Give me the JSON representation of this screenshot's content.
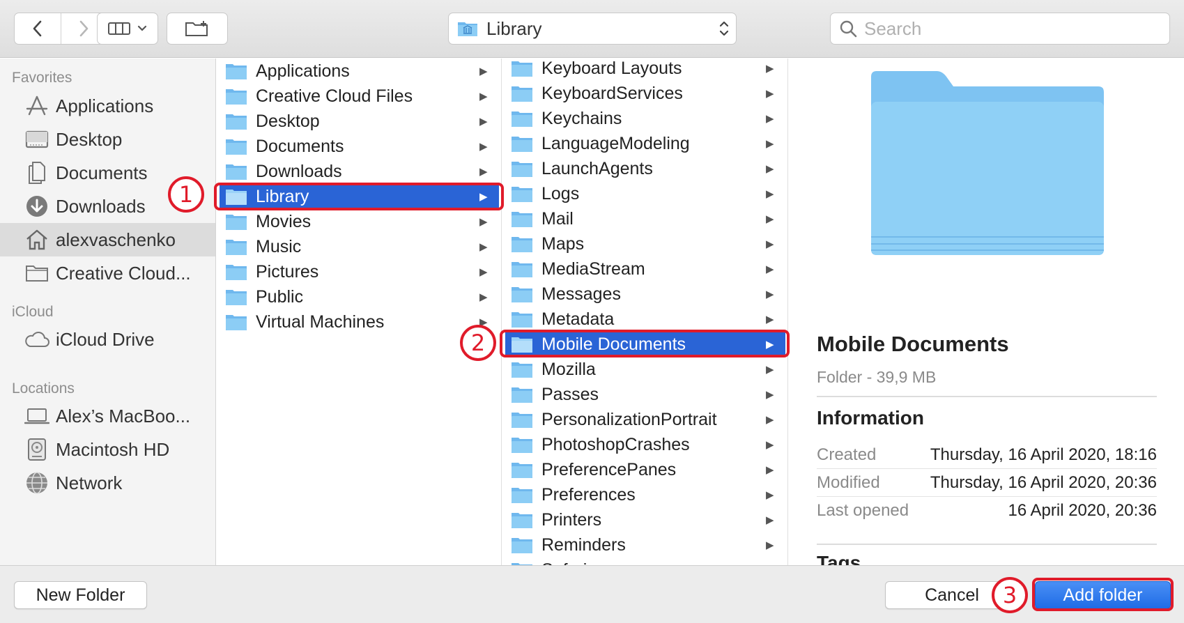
{
  "toolbar": {
    "path_label": "Library",
    "search_placeholder": "Search"
  },
  "sidebar": {
    "sections": [
      {
        "title": "Favorites",
        "items": [
          {
            "label": "Applications",
            "icon": "applications-icon",
            "selected": false
          },
          {
            "label": "Desktop",
            "icon": "desktop-icon",
            "selected": false
          },
          {
            "label": "Documents",
            "icon": "documents-icon",
            "selected": false
          },
          {
            "label": "Downloads",
            "icon": "downloads-icon",
            "selected": false
          },
          {
            "label": "alexvaschenko",
            "icon": "home-icon",
            "selected": true
          },
          {
            "label": "Creative Cloud...",
            "icon": "folder-icon",
            "selected": false
          }
        ]
      },
      {
        "title": "iCloud",
        "items": [
          {
            "label": "iCloud Drive",
            "icon": "cloud-icon",
            "selected": false
          }
        ]
      },
      {
        "title": "Locations",
        "items": [
          {
            "label": "Alex’s MacBoo...",
            "icon": "laptop-icon",
            "selected": false
          },
          {
            "label": "Macintosh HD",
            "icon": "disk-icon",
            "selected": false
          },
          {
            "label": "Network",
            "icon": "network-icon",
            "selected": false
          }
        ]
      }
    ]
  },
  "column1": {
    "items": [
      {
        "label": "Applications",
        "selected": false
      },
      {
        "label": "Creative Cloud Files",
        "selected": false
      },
      {
        "label": "Desktop",
        "selected": false
      },
      {
        "label": "Documents",
        "selected": false
      },
      {
        "label": "Downloads",
        "selected": false
      },
      {
        "label": "Library",
        "selected": true
      },
      {
        "label": "Movies",
        "selected": false
      },
      {
        "label": "Music",
        "selected": false
      },
      {
        "label": "Pictures",
        "selected": false
      },
      {
        "label": "Public",
        "selected": false
      },
      {
        "label": "Virtual Machines",
        "selected": false
      }
    ]
  },
  "column2": {
    "items": [
      {
        "label": "Keyboard Layouts",
        "selected": false
      },
      {
        "label": "KeyboardServices",
        "selected": false
      },
      {
        "label": "Keychains",
        "selected": false
      },
      {
        "label": "LanguageModeling",
        "selected": false
      },
      {
        "label": "LaunchAgents",
        "selected": false
      },
      {
        "label": "Logs",
        "selected": false
      },
      {
        "label": "Mail",
        "selected": false
      },
      {
        "label": "Maps",
        "selected": false
      },
      {
        "label": "MediaStream",
        "selected": false
      },
      {
        "label": "Messages",
        "selected": false
      },
      {
        "label": "Metadata",
        "selected": false
      },
      {
        "label": "Mobile Documents",
        "selected": true
      },
      {
        "label": "Mozilla",
        "selected": false
      },
      {
        "label": "Passes",
        "selected": false
      },
      {
        "label": "PersonalizationPortrait",
        "selected": false
      },
      {
        "label": "PhotoshopCrashes",
        "selected": false
      },
      {
        "label": "PreferencePanes",
        "selected": false
      },
      {
        "label": "Preferences",
        "selected": false
      },
      {
        "label": "Printers",
        "selected": false
      },
      {
        "label": "Reminders",
        "selected": false
      },
      {
        "label": "Safari",
        "selected": false
      }
    ]
  },
  "preview": {
    "title": "Mobile Documents",
    "subtitle": "Folder - 39,9 MB",
    "info_heading": "Information",
    "rows": [
      {
        "key": "Created",
        "value": "Thursday, 16 April 2020, 18:16"
      },
      {
        "key": "Modified",
        "value": "Thursday, 16 April 2020, 20:36"
      },
      {
        "key": "Last opened",
        "value": "16 April 2020, 20:36"
      }
    ],
    "tags_heading": "Tags"
  },
  "bottom": {
    "new_folder": "New Folder",
    "cancel": "Cancel",
    "add_folder": "Add folder"
  },
  "annotations": {
    "step1": "1",
    "step2": "2",
    "step3": "3",
    "color": "#e01b2a"
  },
  "colors": {
    "selection": "#2a64d6",
    "folder": "#7cc3f1"
  }
}
